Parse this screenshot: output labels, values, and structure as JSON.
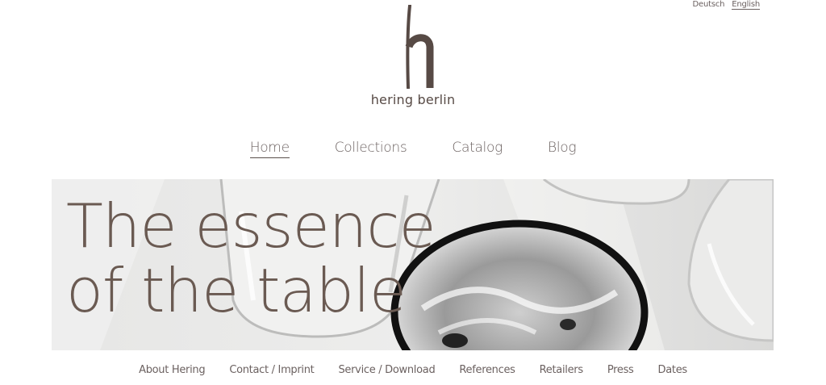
{
  "language": {
    "items": [
      "Deutsch",
      "English"
    ],
    "active": "English"
  },
  "brand": {
    "name": "hering berlin",
    "icon": "h-logo-icon"
  },
  "nav": {
    "items": [
      "Home",
      "Collections",
      "Catalog",
      "Blog"
    ],
    "active": "Home"
  },
  "hero": {
    "line1": "The essence",
    "line2": "of the table"
  },
  "footer": {
    "items": [
      "About Hering",
      "Contact / Imprint",
      "Service / Download",
      "References",
      "Retailers",
      "Press",
      "Dates"
    ]
  },
  "colors": {
    "brand_text": "#5a4f4b",
    "headline": "#6a5a52",
    "hero_bg": "#e9e9e8"
  }
}
